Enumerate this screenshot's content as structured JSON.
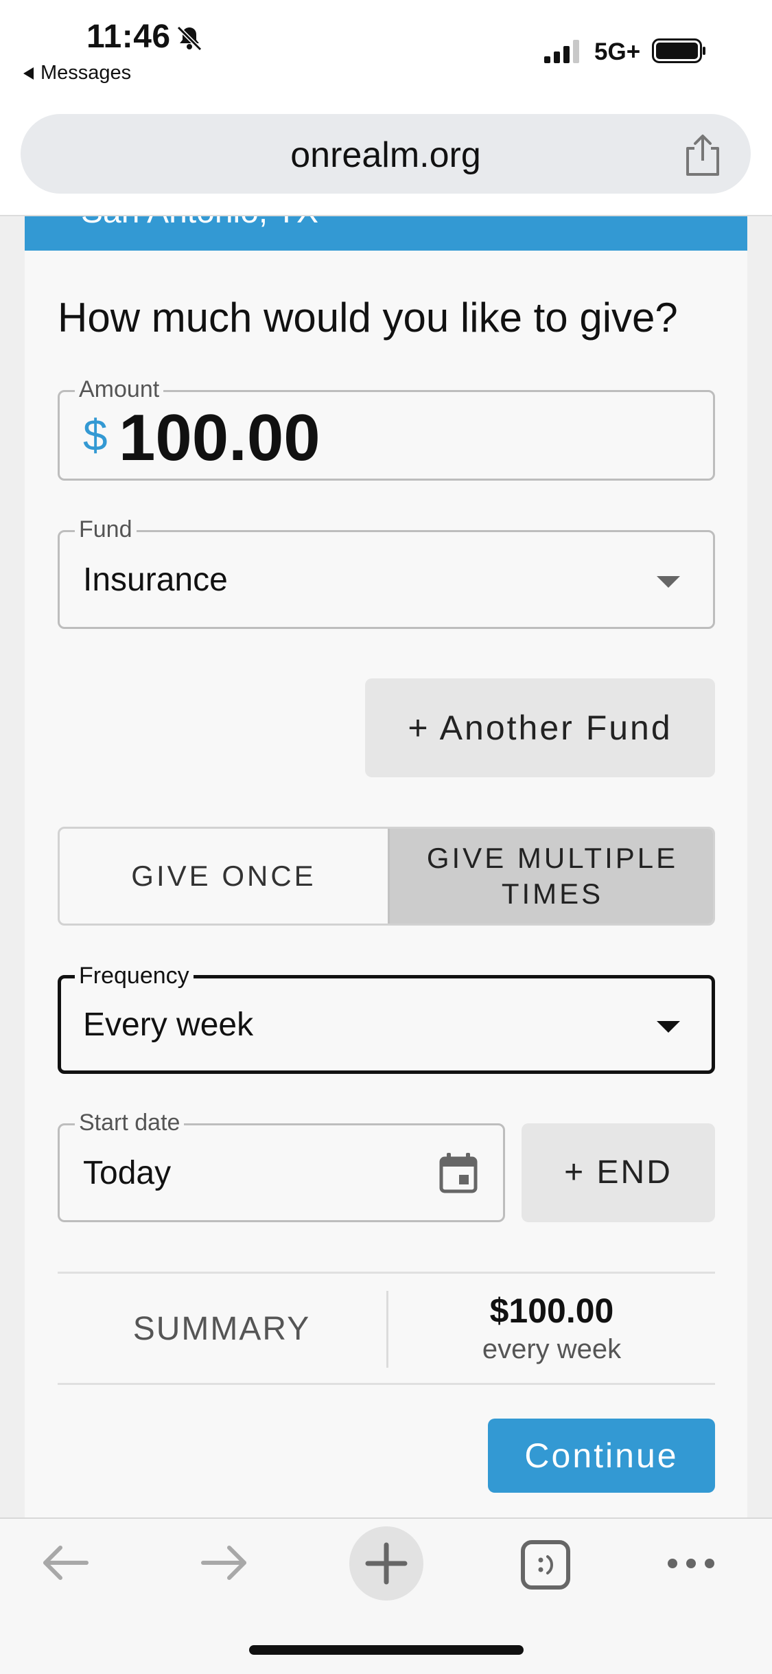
{
  "status_bar": {
    "time": "11:46",
    "back_app": "Messages",
    "network": "5G+"
  },
  "browser": {
    "url": "onrealm.org"
  },
  "org_header": {
    "location": "San Antonio, TX"
  },
  "form": {
    "question": "How much would you like to give?",
    "amount": {
      "label": "Amount",
      "currency_symbol": "$",
      "value": "100.00"
    },
    "fund": {
      "label": "Fund",
      "value": "Insurance"
    },
    "another_fund_label": "+ Another Fund",
    "give_toggle": {
      "once_label": "GIVE ONCE",
      "multiple_label": "GIVE MULTIPLE TIMES",
      "selected": "multiple"
    },
    "frequency": {
      "label": "Frequency",
      "value": "Every week"
    },
    "start_date": {
      "label": "Start date",
      "value": "Today"
    },
    "end_label": "+ END",
    "summary": {
      "label": "SUMMARY",
      "amount": "$100.00",
      "frequency": "every week"
    },
    "continue_label": "Continue"
  },
  "colors": {
    "accent": "#3399d3",
    "selected_toggle": "#cccccc",
    "button_grey": "#e6e6e6"
  },
  "icons": [
    "bell-slash-icon",
    "signal-icon",
    "battery-icon",
    "share-icon",
    "calendar-icon",
    "back-arrow-icon",
    "forward-arrow-icon",
    "new-tab-plus-icon",
    "tabs-icon",
    "more-icon"
  ]
}
